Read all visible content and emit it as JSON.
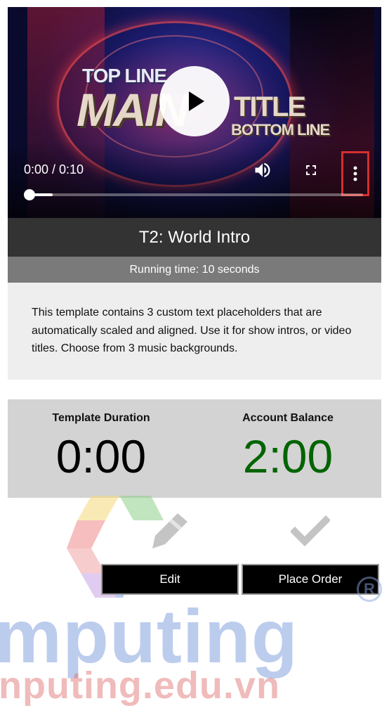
{
  "video": {
    "artwork": {
      "top_line": "TOP LINE",
      "main": "MAIN",
      "title": "TITLE",
      "bottom_line": "BOTTOM LINE"
    },
    "time_display": "0:00 / 0:10",
    "progress_fraction": 0,
    "icons": {
      "play": "play-icon",
      "volume": "volume-icon",
      "fullscreen": "fullscreen-icon",
      "more": "more-vert-icon"
    }
  },
  "template": {
    "title": "T2: World Intro",
    "running_time": "Running time: 10 seconds",
    "description": "This template contains 3 custom text placeholders that are automatically scaled and aligned. Use it for show intros, or video titles. Choose from 3 music backgrounds."
  },
  "stats": {
    "duration_label": "Template Duration",
    "duration_value": "0:00",
    "balance_label": "Account Balance",
    "balance_value": "2:00"
  },
  "actions": {
    "edit_label": "Edit",
    "order_label": "Place Order",
    "edit_icon": "pencil-icon",
    "order_icon": "check-icon"
  },
  "watermark": {
    "big": "mputing",
    "small": "nputing.edu.vn",
    "reg": "R"
  },
  "colors": {
    "title_bar": "#333333",
    "running_bar": "#7a7a7a",
    "balance_value": "#006400",
    "highlight_border": "#d32f2f"
  }
}
